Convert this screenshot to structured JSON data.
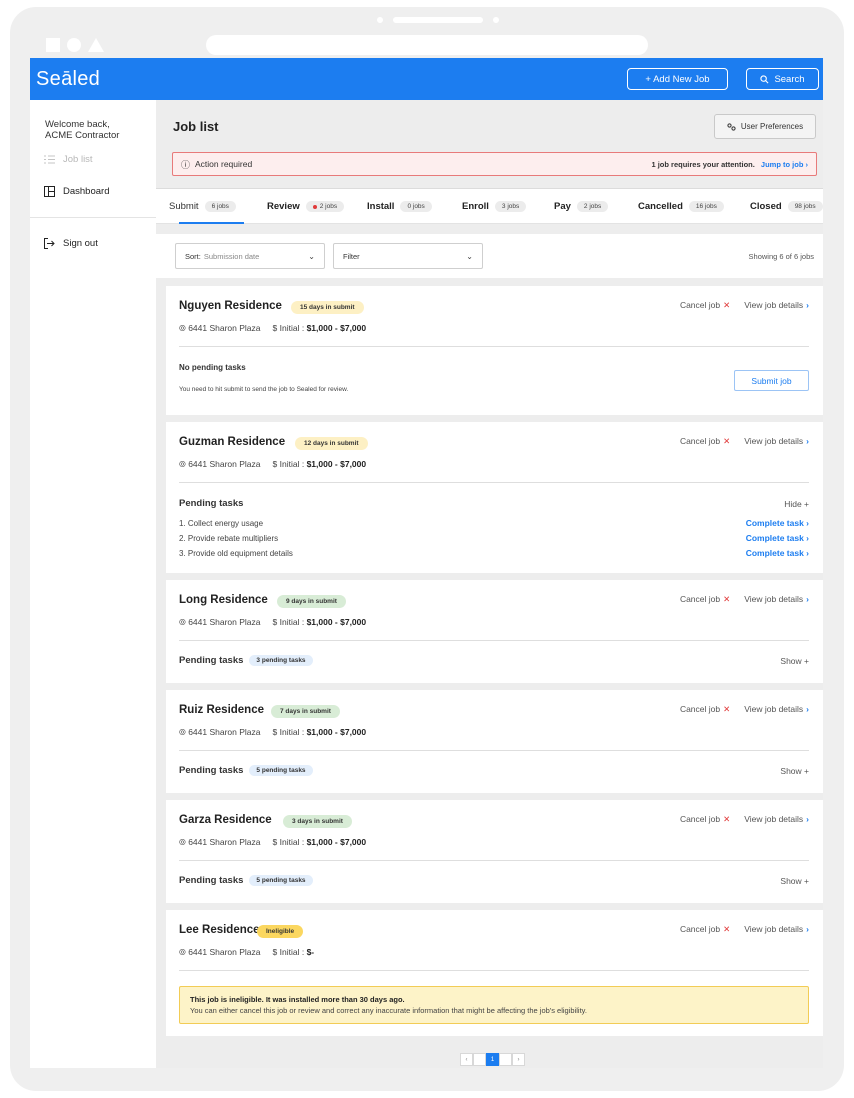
{
  "app": {
    "brand": "Seāled",
    "add_job_label": "+ Add New Job",
    "search_label": "Search"
  },
  "sidebar": {
    "welcome_line1": "Welcome back,",
    "welcome_line2": "ACME Contractor",
    "items": [
      {
        "label": "Job list",
        "icon": "list-icon"
      },
      {
        "label": "Dashboard",
        "icon": "dashboard-icon"
      },
      {
        "label": "Sign out",
        "icon": "sign-out-icon"
      }
    ]
  },
  "header": {
    "title": "Job list",
    "preferences_label": "User Preferences"
  },
  "alert": {
    "label": "Action required",
    "message": "1 job requires your attention.",
    "link": "Jump to job ›"
  },
  "tabs": [
    {
      "label": "Submit",
      "badge": "6 jobs"
    },
    {
      "label": "Review",
      "badge": "2 jobs"
    },
    {
      "label": "Install",
      "badge": "0 jobs"
    },
    {
      "label": "Enroll",
      "badge": "3 jobs"
    },
    {
      "label": "Pay",
      "badge": "2 jobs"
    },
    {
      "label": "Cancelled",
      "badge": "16 jobs"
    },
    {
      "label": "Closed",
      "badge": "98 jobs"
    }
  ],
  "controls": {
    "sort_label": "Sort:",
    "sort_value": "Submission date",
    "filter_label": "Filter",
    "showing": "Showing 6 of 6 jobs"
  },
  "job_common": {
    "address": "6441 Sharon Plaza",
    "initial_label": "Initial :",
    "cancel_label": "Cancel job",
    "details_label": "View job details"
  },
  "jobs": [
    {
      "name": "Nguyen Residence",
      "status": "15 days in submit",
      "range": "$1,000 - $7,000"
    },
    {
      "name": "Guzman Residence",
      "status": "12 days in submit",
      "range": "$1,000 - $7,000"
    },
    {
      "name": "Long Residence",
      "status": "9 days in submit",
      "range": "$1,000 - $7,000"
    },
    {
      "name": "Ruiz Residence",
      "status": "7 days in submit",
      "range": "$1,000 - $7,000"
    },
    {
      "name": "Garza Residence",
      "status": "3 days in submit",
      "range": "$1,000 - $7,000"
    },
    {
      "name": "Lee Residence",
      "status": "Ineligible",
      "range": "$-"
    }
  ],
  "job1": {
    "no_tasks": "No pending tasks",
    "note": "You need to hit submit to send the job to Sealed for review.",
    "submit_label": "Submit job"
  },
  "job2": {
    "pending_title": "Pending tasks",
    "toggle": "Hide +",
    "tasks": [
      "1. Collect energy usage",
      "2. Provide rebate multipliers",
      "3. Provide old equipment details"
    ],
    "task_link": "Complete task ›"
  },
  "collapsed": {
    "pending_title": "Pending tasks",
    "toggle": "Show +",
    "badges": [
      "3 pending tasks",
      "5 pending tasks",
      "5 pending tasks"
    ]
  },
  "ineligible": {
    "line1": "This job is ineligible. It was installed more than 30 days ago.",
    "line2": "You can either cancel this job or review and correct any inaccurate information that might be affecting the job's eligibility."
  },
  "pager": {
    "current": "1"
  },
  "colors": {
    "brand": "#1c7df0",
    "danger": "#e03a3a",
    "warning": "#fdf0c4",
    "success": "#d8ecd6"
  }
}
